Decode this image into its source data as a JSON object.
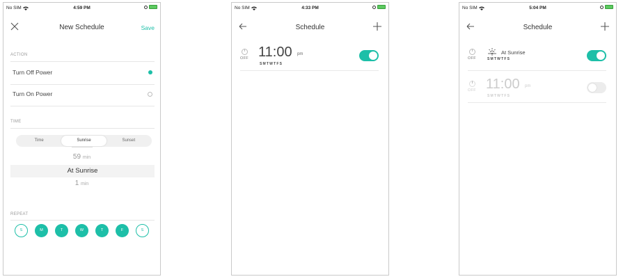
{
  "status_bars": [
    {
      "carrier": "No SIM",
      "time": "4:59 PM"
    },
    {
      "carrier": "No SIM",
      "time": "4:33 PM"
    },
    {
      "carrier": "No SIM",
      "time": "5:04 PM"
    }
  ],
  "new_schedule": {
    "title": "New Schedule",
    "save_label": "Save",
    "action_label": "ACTION",
    "options": [
      {
        "label": "Turn Off Power",
        "selected": true
      },
      {
        "label": "Turn On Power",
        "selected": false
      }
    ],
    "time_label": "TIME",
    "segments": [
      "Time",
      "Sunrise",
      "Sunset"
    ],
    "picker": {
      "above_value": "59",
      "above_unit": "min",
      "selected": "At Sunrise",
      "below_value": "1",
      "below_unit": "min"
    },
    "repeat_label": "REPEAT",
    "days": [
      {
        "label": "S",
        "on": false
      },
      {
        "label": "M",
        "on": true
      },
      {
        "label": "T",
        "on": true
      },
      {
        "label": "W",
        "on": true
      },
      {
        "label": "T",
        "on": true
      },
      {
        "label": "F",
        "on": true
      },
      {
        "label": "S",
        "on": false
      }
    ]
  },
  "schedule_a": {
    "title": "Schedule",
    "rows": [
      {
        "action": "OFF",
        "time": "11:00",
        "ampm": "pm",
        "days": "SMTWTFS",
        "enabled": true
      }
    ]
  },
  "schedule_b": {
    "title": "Schedule",
    "rows": [
      {
        "action": "OFF",
        "label": "At Sunrise",
        "days": "SMTWTFS",
        "enabled": true
      },
      {
        "action": "OFF",
        "time": "11:00",
        "ampm": "pm",
        "days": "SMTWTFS",
        "enabled": false
      }
    ]
  },
  "colors": {
    "accent": "#1dbfa8",
    "battery": "#5cc95f"
  },
  "icons": [
    "close-icon",
    "back-arrow-icon",
    "plus-icon",
    "power-icon",
    "sunrise-icon",
    "wifi-icon"
  ]
}
